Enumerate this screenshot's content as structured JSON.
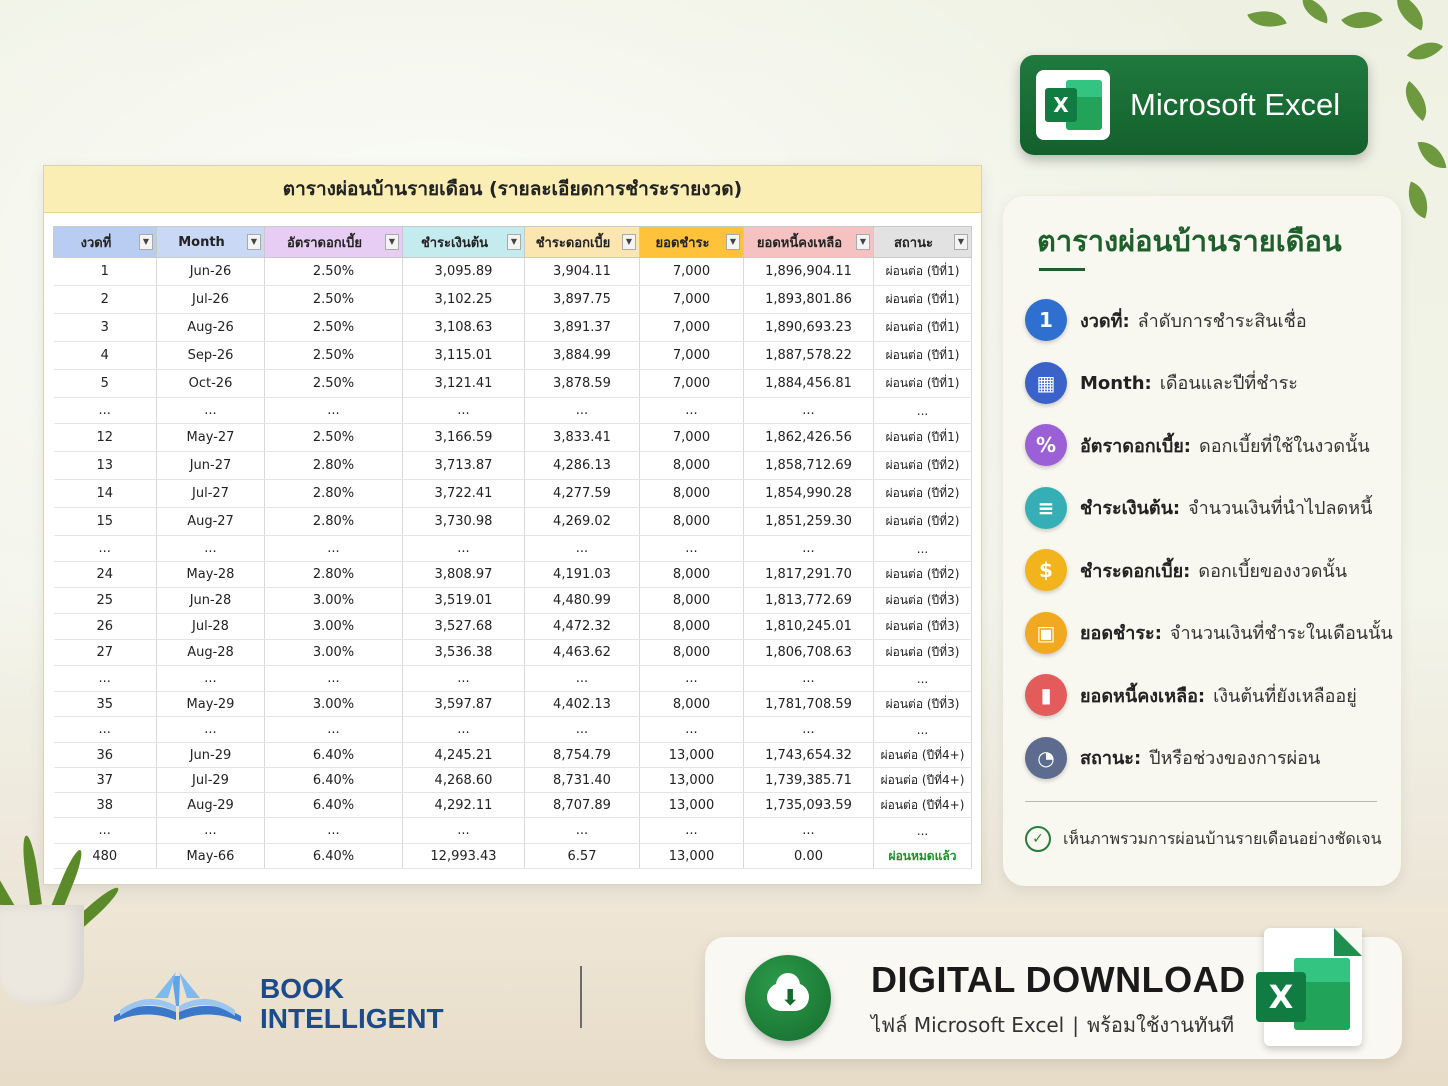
{
  "sheet": {
    "title": "ตารางผ่อนบ้านรายเดือน (รายละเอียดการชำระรายงวด)",
    "columns": [
      {
        "label": "งวดที่",
        "color": "#b9ccf2"
      },
      {
        "label": "Month",
        "color": "#c9d8f4"
      },
      {
        "label": "อัตราดอกเบี้ย",
        "color": "#e7cdf4"
      },
      {
        "label": "ชำระเงินต้น",
        "color": "#c4ecef"
      },
      {
        "label": "ชำระดอกเบี้ย",
        "color": "#fbe5b1"
      },
      {
        "label": "ยอดชำระ",
        "color": "#ffc23a"
      },
      {
        "label": "ยอดหนี้คงเหลือ",
        "color": "#f6c1c1"
      },
      {
        "label": "สถานะ",
        "color": "#e2e2e2"
      }
    ],
    "rows": [
      [
        "1",
        "Jun-26",
        "2.50%",
        "3,095.89",
        "3,904.11",
        "7,000",
        "1,896,904.11",
        "ผ่อนต่อ (ปีที่1)"
      ],
      [
        "2",
        "Jul-26",
        "2.50%",
        "3,102.25",
        "3,897.75",
        "7,000",
        "1,893,801.86",
        "ผ่อนต่อ (ปีที่1)"
      ],
      [
        "3",
        "Aug-26",
        "2.50%",
        "3,108.63",
        "3,891.37",
        "7,000",
        "1,890,693.23",
        "ผ่อนต่อ (ปีที่1)"
      ],
      [
        "4",
        "Sep-26",
        "2.50%",
        "3,115.01",
        "3,884.99",
        "7,000",
        "1,887,578.22",
        "ผ่อนต่อ (ปีที่1)"
      ],
      [
        "5",
        "Oct-26",
        "2.50%",
        "3,121.41",
        "3,878.59",
        "7,000",
        "1,884,456.81",
        "ผ่อนต่อ (ปีที่1)"
      ],
      [
        "...",
        "...",
        "...",
        "...",
        "...",
        "...",
        "...",
        "..."
      ],
      [
        "12",
        "May-27",
        "2.50%",
        "3,166.59",
        "3,833.41",
        "7,000",
        "1,862,426.56",
        "ผ่อนต่อ (ปีที่1)"
      ],
      [
        "13",
        "Jun-27",
        "2.80%",
        "3,713.87",
        "4,286.13",
        "8,000",
        "1,858,712.69",
        "ผ่อนต่อ (ปีที่2)"
      ],
      [
        "14",
        "Jul-27",
        "2.80%",
        "3,722.41",
        "4,277.59",
        "8,000",
        "1,854,990.28",
        "ผ่อนต่อ (ปีที่2)"
      ],
      [
        "15",
        "Aug-27",
        "2.80%",
        "3,730.98",
        "4,269.02",
        "8,000",
        "1,851,259.30",
        "ผ่อนต่อ (ปีที่2)"
      ],
      [
        "...",
        "...",
        "...",
        "...",
        "...",
        "...",
        "...",
        "..."
      ],
      [
        "24",
        "May-28",
        "2.80%",
        "3,808.97",
        "4,191.03",
        "8,000",
        "1,817,291.70",
        "ผ่อนต่อ (ปีที่2)"
      ],
      [
        "25",
        "Jun-28",
        "3.00%",
        "3,519.01",
        "4,480.99",
        "8,000",
        "1,813,772.69",
        "ผ่อนต่อ (ปีที่3)"
      ],
      [
        "26",
        "Jul-28",
        "3.00%",
        "3,527.68",
        "4,472.32",
        "8,000",
        "1,810,245.01",
        "ผ่อนต่อ (ปีที่3)"
      ],
      [
        "27",
        "Aug-28",
        "3.00%",
        "3,536.38",
        "4,463.62",
        "8,000",
        "1,806,708.63",
        "ผ่อนต่อ (ปีที่3)"
      ],
      [
        "...",
        "...",
        "...",
        "...",
        "...",
        "...",
        "...",
        "..."
      ],
      [
        "35",
        "May-29",
        "3.00%",
        "3,597.87",
        "4,402.13",
        "8,000",
        "1,781,708.59",
        "ผ่อนต่อ (ปีที่3)"
      ],
      [
        "...",
        "...",
        "...",
        "...",
        "...",
        "...",
        "...",
        "..."
      ],
      [
        "36",
        "Jun-29",
        "6.40%",
        "4,245.21",
        "8,754.79",
        "13,000",
        "1,743,654.32",
        "ผ่อนต่อ (ปีที่4+)"
      ],
      [
        "37",
        "Jul-29",
        "6.40%",
        "4,268.60",
        "8,731.40",
        "13,000",
        "1,739,385.71",
        "ผ่อนต่อ (ปีที่4+)"
      ],
      [
        "38",
        "Aug-29",
        "6.40%",
        "4,292.11",
        "8,707.89",
        "13,000",
        "1,735,093.59",
        "ผ่อนต่อ (ปีที่4+)"
      ],
      [
        "...",
        "...",
        "...",
        "...",
        "...",
        "...",
        "...",
        "..."
      ],
      [
        "480",
        "May-66",
        "6.40%",
        "12,993.43",
        "6.57",
        "13,000",
        "0.00",
        "ผ่อนหมดแล้ว"
      ]
    ],
    "done_status": "ผ่อนหมดแล้ว"
  },
  "badge": {
    "label": "Microsoft Excel",
    "icon": "excel-icon"
  },
  "legend": {
    "title": "ตารางผ่อนบ้านรายเดือน",
    "items": [
      {
        "icon": "number-one-icon",
        "glyph": "1",
        "color": "#2f6fd0",
        "term": "งวดที่:",
        "desc": "ลำดับการชำระสินเชื่อ"
      },
      {
        "icon": "calendar-icon",
        "glyph": "▦",
        "color": "#3a62c8",
        "term": "Month:",
        "desc": "เดือนและปีที่ชำระ"
      },
      {
        "icon": "percent-icon",
        "glyph": "%",
        "color": "#9b5fd6",
        "term": "อัตราดอกเบี้ย:",
        "desc": "ดอกเบี้ยที่ใช้ในงวดนั้น"
      },
      {
        "icon": "database-icon",
        "glyph": "≡",
        "color": "#35aeb5",
        "term": "ชำระเงินต้น:",
        "desc": "จำนวนเงินที่นำไปลดหนี้"
      },
      {
        "icon": "dollar-coin-icon",
        "glyph": "$",
        "color": "#f2b31c",
        "term": "ชำระดอกเบี้ย:",
        "desc": "ดอกเบี้ยของงวดนั้น"
      },
      {
        "icon": "wallet-icon",
        "glyph": "▣",
        "color": "#f2a922",
        "term": "ยอดชำระ:",
        "desc": "จำนวนเงินที่ชำระในเดือนนั้น"
      },
      {
        "icon": "bar-chart-icon",
        "glyph": "▮",
        "color": "#e35b5b",
        "term": "ยอดหนี้คงเหลือ:",
        "desc": "เงินต้นที่ยังเหลืออยู่"
      },
      {
        "icon": "clock-icon",
        "glyph": "◔",
        "color": "#5d6b8e",
        "term": "สถานะ:",
        "desc": "ปีหรือช่วงของการผ่อน"
      }
    ],
    "footer": "เห็นภาพรวมการผ่อนบ้านรายเดือนอย่างชัดเจน"
  },
  "brand": {
    "line1": "BOOK",
    "line2": "INTELLIGENT"
  },
  "download": {
    "title": "DIGITAL DOWNLOAD",
    "sub1": "ไฟล์ Microsoft Excel",
    "sub2": "พร้อมใช้งานทันที"
  }
}
